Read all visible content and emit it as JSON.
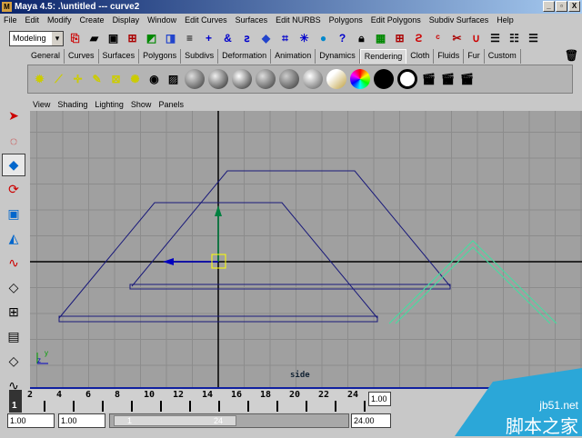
{
  "window": {
    "title": "Maya 4.5: .\\untitled  ---  curve2",
    "minimize": "_",
    "maximize": "▫",
    "close": "X"
  },
  "menu": [
    "File",
    "Edit",
    "Modify",
    "Create",
    "Display",
    "Window",
    "Edit Curves",
    "Surfaces",
    "Edit NURBS",
    "Polygons",
    "Edit Polygons",
    "Subdiv Surfaces",
    "Help"
  ],
  "mode": "Modeling",
  "shelf_tabs": [
    "General",
    "Curves",
    "Surfaces",
    "Polygons",
    "Subdivs",
    "Deformation",
    "Animation",
    "Dynamics",
    "Rendering",
    "Cloth",
    "Fluids",
    "Fur",
    "Custom"
  ],
  "active_tab": "Rendering",
  "panel_menu": [
    "View",
    "Shading",
    "Lighting",
    "Show",
    "Panels"
  ],
  "viewport": {
    "camera": "side",
    "colors": {
      "curve": "#1a1a7a",
      "selected": "#40e0a0",
      "grid": "#8c8c8c",
      "axis": "#000000"
    }
  },
  "timeline": {
    "ticks": [
      "2",
      "4",
      "6",
      "8",
      "10",
      "12",
      "14",
      "16",
      "18",
      "20",
      "22",
      "24"
    ],
    "current_frame": "1",
    "current_time": "1.00"
  },
  "range": {
    "start": "1.00",
    "playback_start": "1.00",
    "slider_start": "1",
    "slider_end": "24",
    "playback_end": "24.00"
  },
  "watermark": {
    "site": "jb51.net",
    "name": "脚本之家"
  }
}
